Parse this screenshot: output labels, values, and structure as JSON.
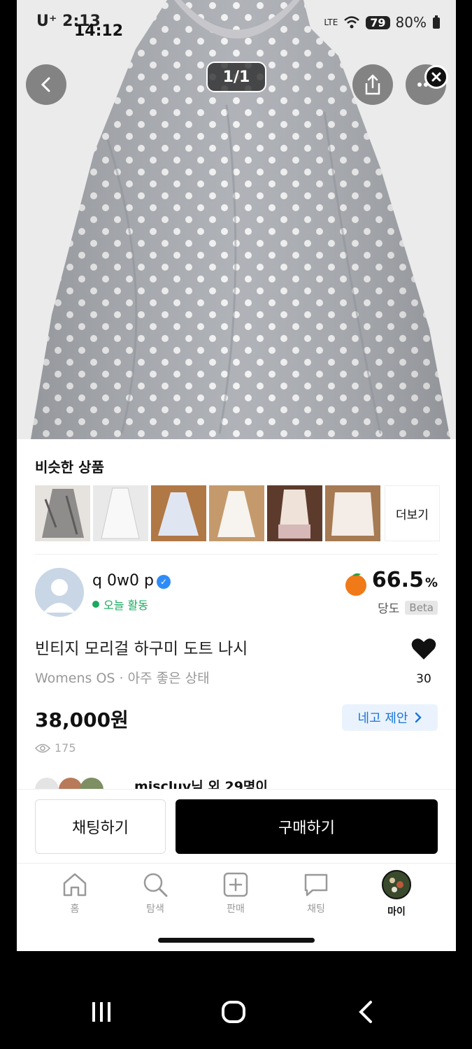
{
  "status_bar": {
    "carrier": "U⁺ 2:13",
    "time_overlay": "14:12",
    "network": "LTE",
    "battery": "80%",
    "battery_badge": "79"
  },
  "photo": {
    "pager": "1/1",
    "dress_color": "#a9acb2",
    "dot_color": "#f2f2f2"
  },
  "similar": {
    "title": "비슷한 상품",
    "more_label": "더보기",
    "thumb_colors": [
      "#8f8c8c",
      "#f3f3f3",
      "#dfe6f2",
      "#f7f3ee",
      "#efe3d9",
      "#f4ece6"
    ]
  },
  "seller": {
    "name": "q 0w0 p",
    "activity": "오늘 활동",
    "sweetness_value": "66.5",
    "sweetness_unit": "%",
    "sweetness_label": "당도",
    "beta": "Beta"
  },
  "product": {
    "title": "빈티지 모리걸 하구미 도트 나시",
    "subtitle": "Womens OS · 아주 좋은 상태",
    "likes": "30",
    "price": "38,000원",
    "offer_label": "네고 제안",
    "views": "175",
    "likers_text": "miscluv님 외 29명이"
  },
  "actions": {
    "chat_label": "채팅하기",
    "buy_label": "구매하기"
  },
  "tabs": [
    {
      "label": "홈",
      "icon": "home-icon"
    },
    {
      "label": "탐색",
      "icon": "search-icon"
    },
    {
      "label": "판매",
      "icon": "plus-square-icon"
    },
    {
      "label": "채팅",
      "icon": "chat-icon"
    },
    {
      "label": "마이",
      "icon": "profile-avatar"
    }
  ],
  "colors": {
    "brand_blue": "#1a73d9",
    "online_green": "#19a95f",
    "verified_blue": "#2f8cf6"
  }
}
